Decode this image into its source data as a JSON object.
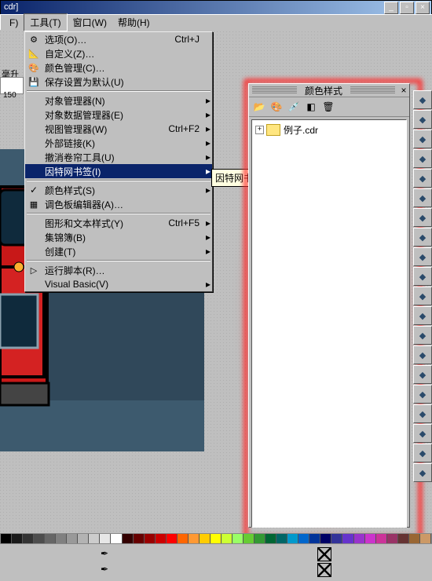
{
  "title_suffix": "cdr]",
  "menubar": {
    "file": "F)",
    "toolmenu_label": "工具(T)",
    "window": "窗口(W)",
    "help": "帮助(H)"
  },
  "unit_label": "毫升",
  "tick": "150",
  "menu": [
    {
      "icon": "⚙",
      "label": "选项(O)…",
      "acc": "Ctrl+J",
      "type": "item"
    },
    {
      "icon": "📐",
      "label": "自定义(Z)…",
      "type": "item"
    },
    {
      "icon": "🎨",
      "label": "颜色管理(C)…",
      "type": "item"
    },
    {
      "icon": "💾",
      "label": "保存设置为默认(U)",
      "type": "item"
    },
    {
      "type": "sep"
    },
    {
      "label": "对象管理器(N)",
      "type": "sub"
    },
    {
      "label": "对象数据管理器(E)",
      "type": "sub"
    },
    {
      "label": "视图管理器(W)",
      "acc": "Ctrl+F2",
      "type": "sub"
    },
    {
      "label": "外部链接(K)",
      "type": "sub"
    },
    {
      "label": "撤消卷帘工具(U)",
      "type": "sub"
    },
    {
      "label": "因特网书签(I)",
      "type": "sub",
      "hl": true
    },
    {
      "type": "sep"
    },
    {
      "chk": true,
      "label": "颜色样式(S)",
      "type": "sub"
    },
    {
      "icon": "▦",
      "label": "调色板编辑器(A)…",
      "type": "item"
    },
    {
      "type": "sep"
    },
    {
      "label": "图形和文本样式(Y)",
      "acc": "Ctrl+F5",
      "type": "sub"
    },
    {
      "label": "集锦簿(B)",
      "type": "sub"
    },
    {
      "label": "创建(T)",
      "type": "sub"
    },
    {
      "type": "sep"
    },
    {
      "icon": "▷",
      "label": "运行脚本(R)…",
      "type": "item"
    },
    {
      "label": "Visual Basic(V)",
      "type": "sub"
    }
  ],
  "tooltip": "因特网书签管理器",
  "dock": {
    "title": "颜色样式",
    "toolbar_icons": [
      "folder-open-icon",
      "palette-icon",
      "eyedropper-icon",
      "blend-icon",
      "delete-icon"
    ],
    "file": "例子.cdr"
  },
  "right_tools": [
    "star",
    "arrow-sw",
    "plus",
    "plus-group",
    "stack",
    "layers",
    "shape-a",
    "shape-b",
    "gradient",
    "star2",
    "poly",
    "burst",
    "free",
    "spiral",
    "eye",
    "circle",
    "lock",
    "search",
    "info",
    "cube"
  ],
  "palette": [
    "#000000",
    "#1a1a1a",
    "#333333",
    "#4d4d4d",
    "#666666",
    "#808080",
    "#999999",
    "#b3b3b3",
    "#cccccc",
    "#e6e6e6",
    "#ffffff",
    "#330000",
    "#660000",
    "#990000",
    "#cc0000",
    "#ff0000",
    "#ff6600",
    "#ff9933",
    "#ffcc00",
    "#ffff00",
    "#ccff33",
    "#99ff66",
    "#66cc33",
    "#339933",
    "#006633",
    "#006666",
    "#0099cc",
    "#0066cc",
    "#003399",
    "#000066",
    "#333399",
    "#6633cc",
    "#9933cc",
    "#cc33cc",
    "#cc3399",
    "#993366",
    "#663333",
    "#996633",
    "#cc9966"
  ]
}
